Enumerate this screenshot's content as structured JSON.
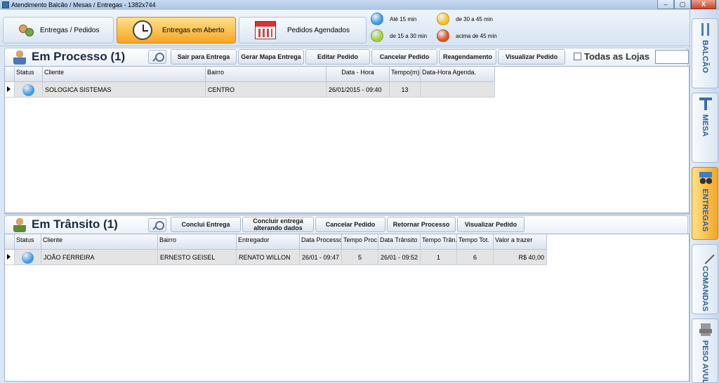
{
  "window": {
    "title": "Atendimento Balcão / Mesas / Entregas - 1382x744"
  },
  "window_buttons": {
    "minimize": "–",
    "maximize": "▢",
    "close": "X"
  },
  "tabs": [
    {
      "label": "Entregas / Pedidos"
    },
    {
      "label": "Entregas em Aberto"
    },
    {
      "label": "Pedidos Agendados"
    }
  ],
  "legend": [
    {
      "label": "Até 15 min",
      "color": "#3d9be9"
    },
    {
      "label": "de 15 a 30 min",
      "color": "#a6cf3a"
    },
    {
      "label": "de 30 a 45 min",
      "color": "#f8c31b"
    },
    {
      "label": "acima de 45 min",
      "color": "#e0531f"
    }
  ],
  "processo": {
    "title": "Em Processo (1)",
    "buttons": [
      "Sair para Entrega",
      "Gerar Mapa Entrega",
      "Editar Pedido",
      "Cancelar Pedido",
      "Reagendamento",
      "Visualizar Pedido"
    ],
    "todas_lojas": "Todas as Lojas",
    "columns": [
      "Status",
      "Cliente",
      "Bairro",
      "Data - Hora",
      "Tempo(m)",
      "Data-Hora Agenda."
    ],
    "rows": [
      {
        "status_color": "#3d9be9",
        "cliente": "SOLOGICA SISTEMAS",
        "bairro": "CENTRO",
        "data_hora": "26/01/2015 - 09:40",
        "tempo": "13",
        "agenda": ""
      }
    ]
  },
  "transito": {
    "title": "Em Trânsito (1)",
    "buttons": [
      "Conclui Entrega",
      "Concluir entrega alterando dados",
      "Cancelar Pedido",
      "Retornar Processo",
      "Visualizar Pedido"
    ],
    "columns": [
      "Status",
      "Cliente",
      "Bairro",
      "Entregador",
      "Data Processo",
      "Tempo Proc.",
      "Data Trânsito",
      "Tempo Trân.",
      "Tempo Tot.",
      "Valor a trazer"
    ],
    "rows": [
      {
        "status_color": "#3d9be9",
        "cliente": "JOÃO FERREIRA",
        "bairro": "ERNESTO GEISEL",
        "entregador": "RENATO WILLON",
        "data_processo": "26/01 - 09:47",
        "tempo_proc": "5",
        "data_transito": "26/01 - 09:52",
        "tempo_tran": "1",
        "tempo_tot": "6",
        "valor": "R$ 40,00"
      }
    ]
  },
  "side_tabs": [
    {
      "label": "BALCÃO",
      "icon": "cutlery-icon"
    },
    {
      "label": "MESA",
      "icon": "table-icon"
    },
    {
      "label": "ENTREGAS",
      "icon": "moto-icon"
    },
    {
      "label": "COMANDAS",
      "icon": "pen-icon"
    },
    {
      "label": "PESO AVULSO",
      "icon": "scale-icon"
    }
  ]
}
